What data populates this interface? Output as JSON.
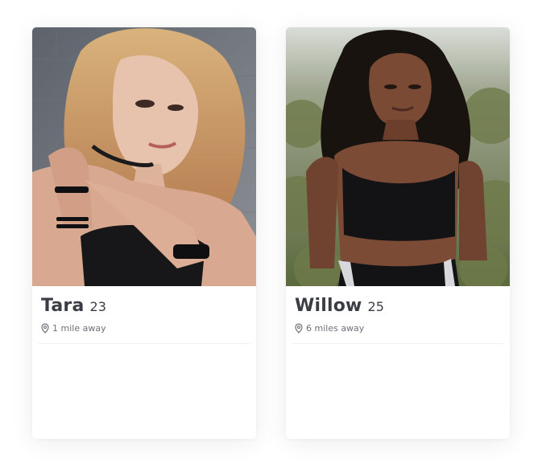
{
  "cards": [
    {
      "name": "Tara",
      "age": "23",
      "distance": "1 mile away",
      "icon": "map-pin-icon"
    },
    {
      "name": "Willow",
      "age": "25",
      "distance": "6 miles away",
      "icon": "map-pin-icon"
    }
  ],
  "colors": {
    "text": "#3a3d44",
    "muted": "#6d7079",
    "card": "#ffffff"
  }
}
